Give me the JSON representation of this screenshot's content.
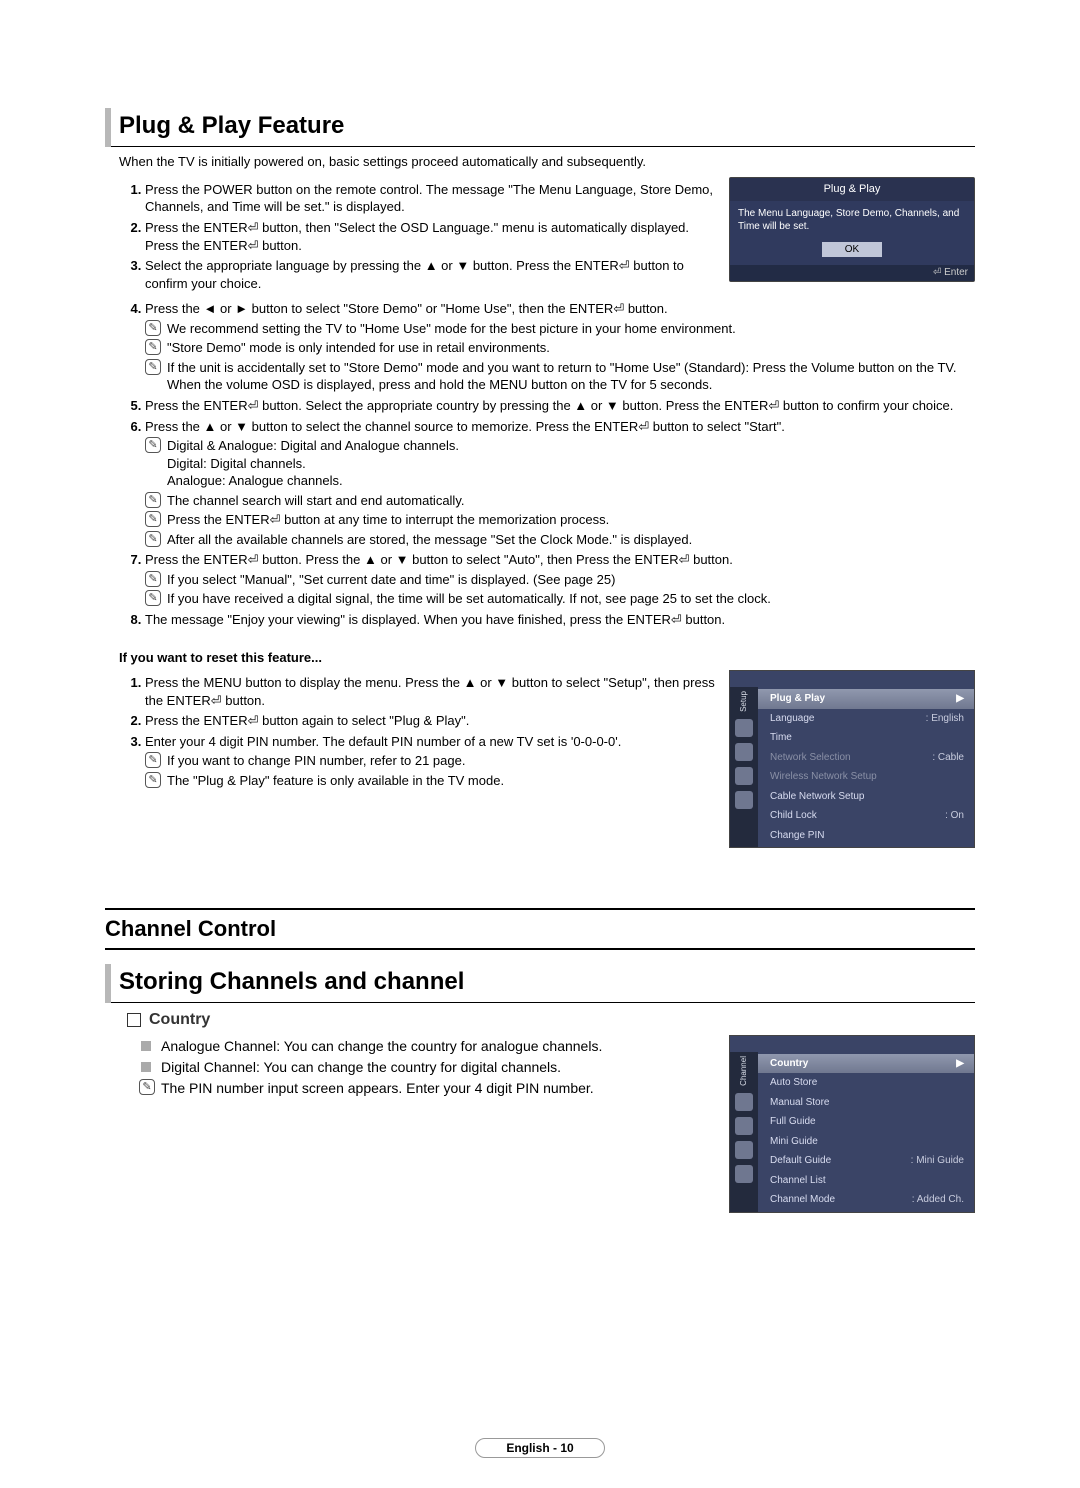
{
  "h1": "Plug & Play Feature",
  "desc": "When the TV is initially powered on, basic settings proceed automatically and subsequently.",
  "steps1_1": "Press the POWER button on the remote control. The message \"The Menu Language, Store Demo, Channels, and Time will be set.\" is displayed.",
  "steps1_2": "Press the ENTER⏎ button, then \"Select the OSD Language.\" menu is automatically displayed. Press the ENTER⏎ button.",
  "steps1_3": "Select the appropriate language by pressing the ▲ or ▼ button. Press the ENTER⏎ button to confirm your choice.",
  "steps1_4": "Press the ◄ or ► button to select \"Store Demo\" or \"Home Use\", then the ENTER⏎ button.",
  "steps1_4a": "We recommend setting the TV to \"Home Use\" mode for the best picture in your home environment.",
  "steps1_4b": "\"Store Demo\" mode is only intended for use in retail environments.",
  "steps1_4c": "If the unit is accidentally set to \"Store Demo\" mode and you want to return to \"Home Use\" (Standard): Press the Volume button on the TV. When the volume OSD is displayed, press and hold the MENU button on the TV for 5 seconds.",
  "steps1_5": "Press the ENTER⏎ button. Select the appropriate country by pressing the ▲ or ▼ button. Press the ENTER⏎ button to confirm your choice.",
  "steps1_6": "Press the ▲ or ▼ button to select the channel source to memorize. Press the ENTER⏎ button to select \"Start\".",
  "steps1_6a": "Digital & Analogue: Digital and Analogue channels.",
  "steps1_6a2": "Digital: Digital channels.",
  "steps1_6a3": "Analogue: Analogue channels.",
  "steps1_6b": "The channel search will start and end automatically.",
  "steps1_6c": "Press the ENTER⏎ button at any time to interrupt the memorization process.",
  "steps1_6d": "After all the available channels are stored, the message \"Set the Clock Mode.\" is displayed.",
  "steps1_7": "Press the ENTER⏎ button. Press the ▲ or ▼ button to select \"Auto\", then Press the ENTER⏎ button.",
  "steps1_7a": "If you select \"Manual\", \"Set current date and time\" is displayed. (See page 25)",
  "steps1_7b": "If you have received a digital signal, the time will be set automatically. If not, see page 25 to set the clock.",
  "steps1_8": "The message \"Enjoy your viewing\" is displayed. When you have finished, press the ENTER⏎ button.",
  "reset_hdr": "If you want to reset this feature...",
  "reset_1": "Press the MENU button to display the menu. Press the ▲ or ▼ button to select \"Setup\", then press the ENTER⏎ button.",
  "reset_2": "Press the ENTER⏎ button again to select \"Plug & Play\".",
  "reset_3": "Enter your 4 digit PIN number. The default PIN number of a new TV set is '0-0-0-0'.",
  "reset_3a": "If you want to change PIN number, refer to 21 page.",
  "reset_3b": "The \"Plug & Play\" feature is only available in the TV mode.",
  "popup": {
    "title": "Plug & Play",
    "msg": "The Menu Language, Store Demo, Channels, and Time will be set.",
    "ok": "OK",
    "enter": "⏎ Enter"
  },
  "setup_menu": {
    "tab": "Setup",
    "items": {
      "plug": "Plug & Play",
      "lang": "Language",
      "lang_val": ": English",
      "time": "Time",
      "ns": "Network Selection",
      "ns_val": ": Cable",
      "wns": "Wireless Network Setup",
      "cns": "Cable Network Setup",
      "cl": "Child Lock",
      "cl_val": ": On",
      "cp": "Change PIN"
    }
  },
  "h2": "Channel Control",
  "h3": "Storing Channels and channel",
  "h3_sub": "Country",
  "cc_a": "Analogue Channel: You can change the country for analogue channels.",
  "cc_b": "Digital Channel: You can change the country for digital channels.",
  "cc_c": "The PIN number input screen appears. Enter your 4 digit PIN number.",
  "channel_menu": {
    "tab": "Channel",
    "items": {
      "country": "Country",
      "auto": "Auto Store",
      "manual": "Manual Store",
      "fg": "Full Guide",
      "mg": "Mini Guide",
      "dg": "Default Guide",
      "dg_val": ": Mini Guide",
      "cl": "Channel List",
      "cm": "Channel Mode",
      "cm_val": ": Added Ch."
    }
  },
  "footer": "English - 10"
}
